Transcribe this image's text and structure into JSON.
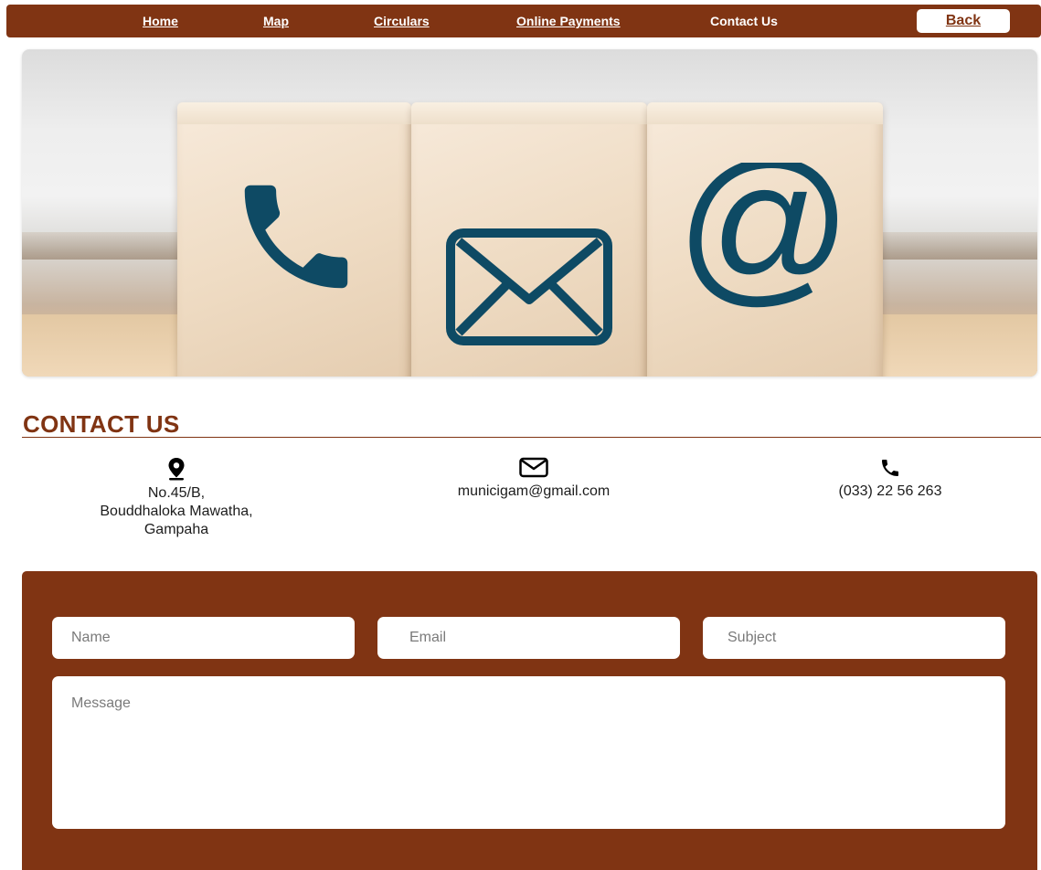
{
  "nav": {
    "items": [
      {
        "label": "Home"
      },
      {
        "label": "Map"
      },
      {
        "label": "Circulars"
      },
      {
        "label": "Online Payments"
      },
      {
        "label": "Contact Us"
      }
    ],
    "back_label": "Back"
  },
  "hero": {
    "icons": [
      "phone-icon",
      "envelope-icon",
      "at-sign-icon"
    ]
  },
  "contact": {
    "title": "CONTACT US",
    "address": {
      "icon": "location-pin-icon",
      "lines": [
        "No.45/B,",
        "Bouddhaloka Mawatha,",
        "Gampaha"
      ]
    },
    "email": {
      "icon": "envelope-icon",
      "value": "municigam@gmail.com"
    },
    "phone": {
      "icon": "phone-icon",
      "value": "(033) 22 56 263"
    }
  },
  "form": {
    "name_placeholder": "Name",
    "email_placeholder": "Email",
    "subject_placeholder": "Subject",
    "message_placeholder": "Message"
  },
  "colors": {
    "brand": "#803413",
    "icon_blue": "#0e4a64"
  }
}
